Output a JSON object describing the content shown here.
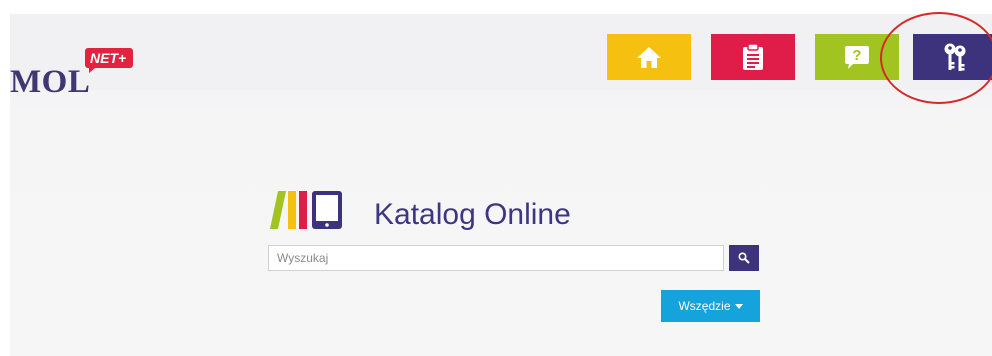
{
  "header": {
    "logo": {
      "text": "MOL",
      "badge": "NET+"
    },
    "nav": [
      {
        "name": "home",
        "icon": "home-icon",
        "color": "#f6c010"
      },
      {
        "name": "list",
        "icon": "clipboard-list-icon",
        "color": "#e01c48"
      },
      {
        "name": "help",
        "icon": "question-bubble-icon",
        "color": "#a2c421"
      },
      {
        "name": "login",
        "icon": "keys-icon",
        "color": "#3d337d"
      }
    ],
    "annotation": {
      "shape": "red-ellipse-around-login",
      "color": "#d42a2a"
    }
  },
  "brand": {
    "title": "Katalog Online",
    "icon": "books-tablet-icon",
    "colors": [
      "#a2c421",
      "#f6c010",
      "#e01c48",
      "#3d337d"
    ]
  },
  "search": {
    "placeholder": "Wyszukaj",
    "value": "",
    "button_icon": "search-icon",
    "scope": {
      "label": "Wszędzie",
      "icon": "caret-down-icon",
      "color": "#14a3db"
    }
  }
}
